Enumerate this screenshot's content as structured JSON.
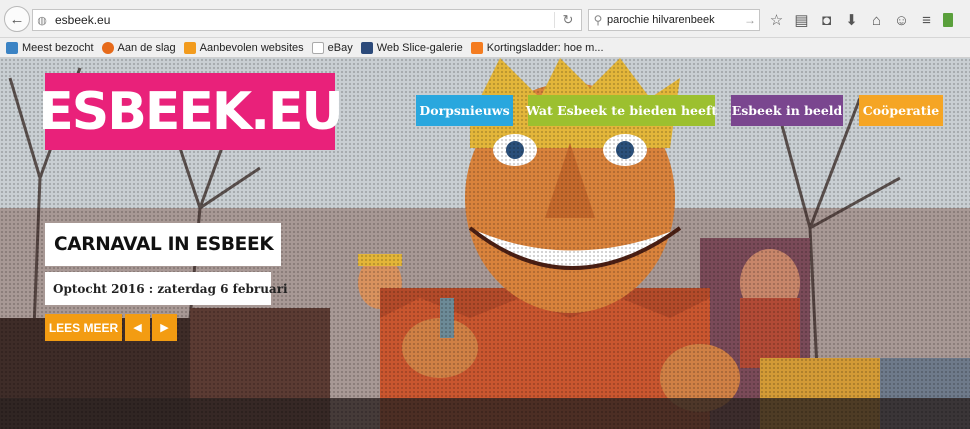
{
  "browser": {
    "url": "esbeek.eu",
    "search_text": "parochie hilvarenbeek",
    "icons": [
      "back-arrow-icon",
      "globe-icon",
      "reload-icon",
      "search-icon",
      "go-arrow-icon",
      "star-icon",
      "reading-list-icon",
      "pocket-icon",
      "download-icon",
      "home-icon",
      "hello-icon",
      "menu-icon"
    ]
  },
  "bookmarks": [
    {
      "label": "Meest bezocht",
      "icon_color": "#3b83c4"
    },
    {
      "label": "Aan de slag",
      "icon_color": "#e66a1a"
    },
    {
      "label": "Aanbevolen websites",
      "icon_color": "#f29b1d"
    },
    {
      "label": "eBay",
      "icon_color": "#dcdcdc"
    },
    {
      "label": "Web Slice-galerie",
      "icon_color": "#2c4a7a"
    },
    {
      "label": "Kortingsladder: hoe m...",
      "icon_color": "#f47c20"
    }
  ],
  "site": {
    "logo_text": "ESBEEK.EU",
    "nav": [
      {
        "label": "Dorpsnieuws",
        "color": "#29a7de"
      },
      {
        "label": "Wat Esbeek te bieden heeft",
        "color": "#9cc02f"
      },
      {
        "label": "Esbeek in beeld",
        "color": "#7a468f"
      },
      {
        "label": "Coöperatie",
        "color": "#f5a524"
      }
    ],
    "slide": {
      "title": "CARNAVAL IN ESBEEK",
      "subtitle": "Optocht 2016 : zaterdag 6 februari",
      "more_label": "LEES MEER",
      "prev_icon": "◀",
      "next_icon": "▶"
    },
    "colors": {
      "logo": "#e9217a",
      "button": "#f39c12"
    }
  }
}
